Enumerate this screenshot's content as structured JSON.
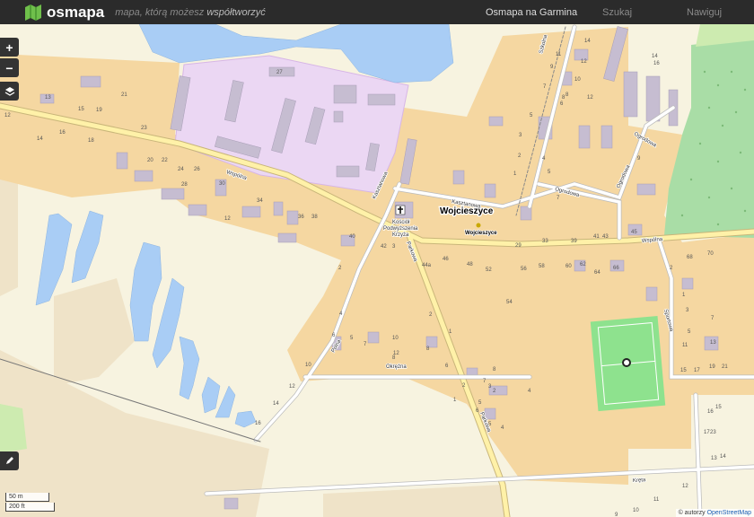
{
  "app": {
    "name": "osmapa",
    "tagline_prefix": "mapa, którą możesz ",
    "tagline_emph": "współtworzyć",
    "nav": [
      "Osmapa na Garmina",
      "Szukaj",
      "Nawiguj"
    ]
  },
  "controls": {
    "zoom_in": "+",
    "zoom_out": "−"
  },
  "scale": {
    "metric": "50 m",
    "imperial": "200 ft"
  },
  "attribution": {
    "prefix": "© autorzy ",
    "link": "OpenStreetMap"
  },
  "places": {
    "village": "Wojcieszyce",
    "village_small": "Wojcieszyce",
    "church": [
      "Kościół",
      "Podwyższenia",
      "Krzyża"
    ]
  },
  "streets": [
    "Wspólna",
    "Wspólna",
    "Kasztanowa",
    "Kasztanowa",
    "Szkolna",
    "Ogrodowa",
    "Ogrodowa",
    "Ogrodowa",
    "Sportowa",
    "Polna",
    "Parkowa",
    "Parkowa",
    "Kręta",
    "Okrężna"
  ],
  "house_numbers": [
    "27",
    "13",
    "15",
    "19",
    "21",
    "23",
    "12",
    "16",
    "18",
    "14",
    "20",
    "22",
    "24",
    "26",
    "28",
    "30",
    "34",
    "36",
    "38",
    "12",
    "40",
    "42",
    "3",
    "44a",
    "46",
    "48",
    "52",
    "56",
    "58",
    "60",
    "62",
    "64",
    "66",
    "54",
    "1",
    "2",
    "2",
    "4",
    "5",
    "6",
    "7",
    "8",
    "10",
    "12",
    "14",
    "16",
    "11",
    "9",
    "7",
    "14",
    "12",
    "10",
    "8",
    "6",
    "5",
    "3",
    "2",
    "1",
    "8",
    "12",
    "14",
    "16",
    "45",
    "41",
    "43",
    "39",
    "33",
    "29",
    "4",
    "5",
    "7",
    "9",
    "68",
    "70",
    "2",
    "1",
    "3",
    "5",
    "7",
    "11",
    "13",
    "15",
    "17",
    "19",
    "21",
    "23",
    "15",
    "16",
    "17",
    "14",
    "13",
    "12",
    "11",
    "10",
    "9",
    "8",
    "7",
    "6",
    "5",
    "4",
    "3",
    "2",
    "1",
    "5",
    "2",
    "4",
    "6",
    "8",
    "10",
    "12",
    "14",
    "16",
    "8",
    "7",
    "6",
    "3",
    "4",
    "5",
    "6"
  ],
  "colors": {
    "residential": "#f5d7a1",
    "water": "#a9cdf5",
    "industrial": "#ebd7f3",
    "forest": "#a9dda6",
    "grass": "#cdebb0",
    "pitch": "#8ee28e",
    "building": "#c6bdd1",
    "field": "#efe3c8",
    "road": "#fff1a8",
    "road_casing": "#c9b67a"
  }
}
